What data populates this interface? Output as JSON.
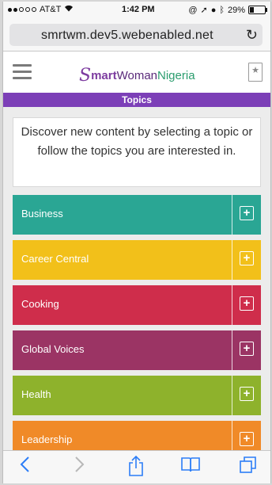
{
  "status_bar": {
    "carrier": "AT&T",
    "time": "1:42 PM",
    "battery_percent": "29%",
    "battery_level": 0.29,
    "signal_dots": [
      true,
      true,
      false,
      false,
      false
    ]
  },
  "browser": {
    "url": "smrtwm.dev5.webenabled.net"
  },
  "site": {
    "logo": {
      "s": "S",
      "smart": "mart",
      "woman": "Woman",
      "nigeria": "Nigeria"
    },
    "bookmark_symbol": "★"
  },
  "topics_header": "Topics",
  "intro_text": "Discover new content by selecting a topic or follow the topics you are interested in.",
  "topics": [
    {
      "label": "Business",
      "color": "#2aa694"
    },
    {
      "label": "Career Central",
      "color": "#f2c01a"
    },
    {
      "label": "Cooking",
      "color": "#cf2d4b"
    },
    {
      "label": "Global Voices",
      "color": "#9b3464"
    },
    {
      "label": "Health",
      "color": "#8eb22c"
    },
    {
      "label": "Leadership",
      "color": "#f08a28"
    }
  ],
  "colors": {
    "accent_purple": "#7c3fb7",
    "ios_blue": "#2c7df7"
  }
}
